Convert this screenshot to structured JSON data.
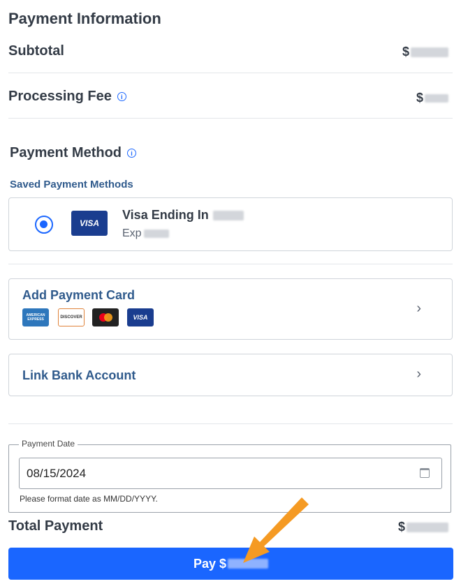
{
  "payment": {
    "title": "Payment Information",
    "subtotal_label": "Subtotal",
    "subtotal_amount": "$",
    "fee_label": "Processing Fee",
    "fee_amount": "$"
  },
  "method": {
    "title": "Payment Method",
    "saved_label": "Saved Payment Methods",
    "saved_card": {
      "brand": "VISA",
      "title": "Visa Ending In",
      "exp_label": "Exp"
    },
    "add_card_label": "Add Payment Card",
    "card_brands": [
      "AMERICAN EXPRESS",
      "DISCOVER",
      "VISA"
    ],
    "link_bank_label": "Link Bank Account"
  },
  "date": {
    "legend": "Payment Date",
    "value": "08/15/2024",
    "hint": "Please format date as MM/DD/YYYY."
  },
  "total": {
    "label": "Total Payment",
    "amount": "$"
  },
  "pay_button": {
    "label": "Pay $"
  },
  "colors": {
    "accent": "#1a66ff",
    "visa_blue": "#1a3d8f",
    "arrow": "#f59a23"
  }
}
